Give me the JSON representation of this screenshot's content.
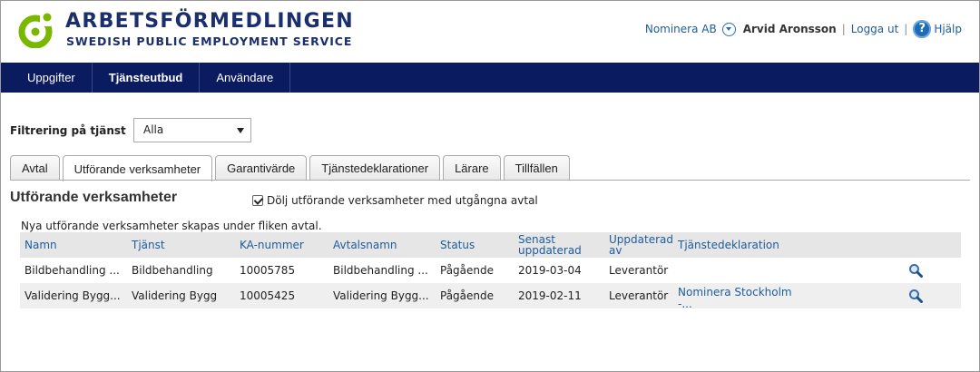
{
  "header": {
    "logo_title": "ARBETSFÖRMEDLINGEN",
    "logo_subtitle": "SWEDISH PUBLIC EMPLOYMENT SERVICE",
    "org_link": "Nominera AB",
    "user_name": "Arvid Aronsson",
    "separator": "|",
    "logout_link": "Logga ut",
    "help_link": "Hjälp",
    "help_icon_glyph": "?"
  },
  "nav": {
    "items": [
      "Uppgifter",
      "Tjänsteutbud",
      "Användare"
    ],
    "active_index": 1
  },
  "filter": {
    "label": "Filtrering på tjänst",
    "selected": "Alla"
  },
  "tabs": {
    "items": [
      "Avtal",
      "Utförande verksamheter",
      "Garantivärde",
      "Tjänstedeklarationer",
      "Lärare",
      "Tillfällen"
    ],
    "active_index": 1
  },
  "section": {
    "title": "Utförande verksamheter",
    "checkbox_label": "Dölj utförande verksamheter med utgångna avtal",
    "checkbox_checked": true,
    "info_text": "Nya utförande verksamheter skapas under fliken avtal."
  },
  "table": {
    "headers": {
      "namn": "Namn",
      "tjanst": "Tjänst",
      "ka": "KA-nummer",
      "avtal": "Avtalsnamn",
      "status": "Status",
      "senast_1": "Senast",
      "senast_2": "uppdaterad",
      "uppd_1": "Uppdaterad",
      "uppd_2": "av",
      "tjanstedekl": "Tjänstedeklaration"
    },
    "rows": [
      {
        "namn": "Bildbehandling ...",
        "tjanst": "Bildbehandling",
        "ka": "10005785",
        "avtal": "Bildbehandling ...",
        "status": "Pågående",
        "senast": "2019-03-04",
        "uppd": "Leverantör",
        "tjanstedekl_1": "",
        "tjanstedekl_2": ""
      },
      {
        "namn": "Validering Bygg...",
        "tjanst": "Validering Bygg",
        "ka": "10005425",
        "avtal": "Validering Bygg...",
        "status": "Pågående",
        "senast": "2019-02-11",
        "uppd": "Leverantör",
        "tjanstedekl_1": "Nominera Stockholm",
        "tjanstedekl_2": "-..."
      }
    ]
  },
  "colors": {
    "brand_navy": "#1b2f6e",
    "nav_bg": "#0b1b5f",
    "logo_green": "#7ab800",
    "link_blue": "#1e5c9c"
  },
  "icons": {
    "logo": "af-logo-icon",
    "org_dropdown": "chevron-down-icon",
    "help": "help-icon",
    "row_view": "magnifier-icon",
    "select_arrow": "caret-down-icon"
  }
}
